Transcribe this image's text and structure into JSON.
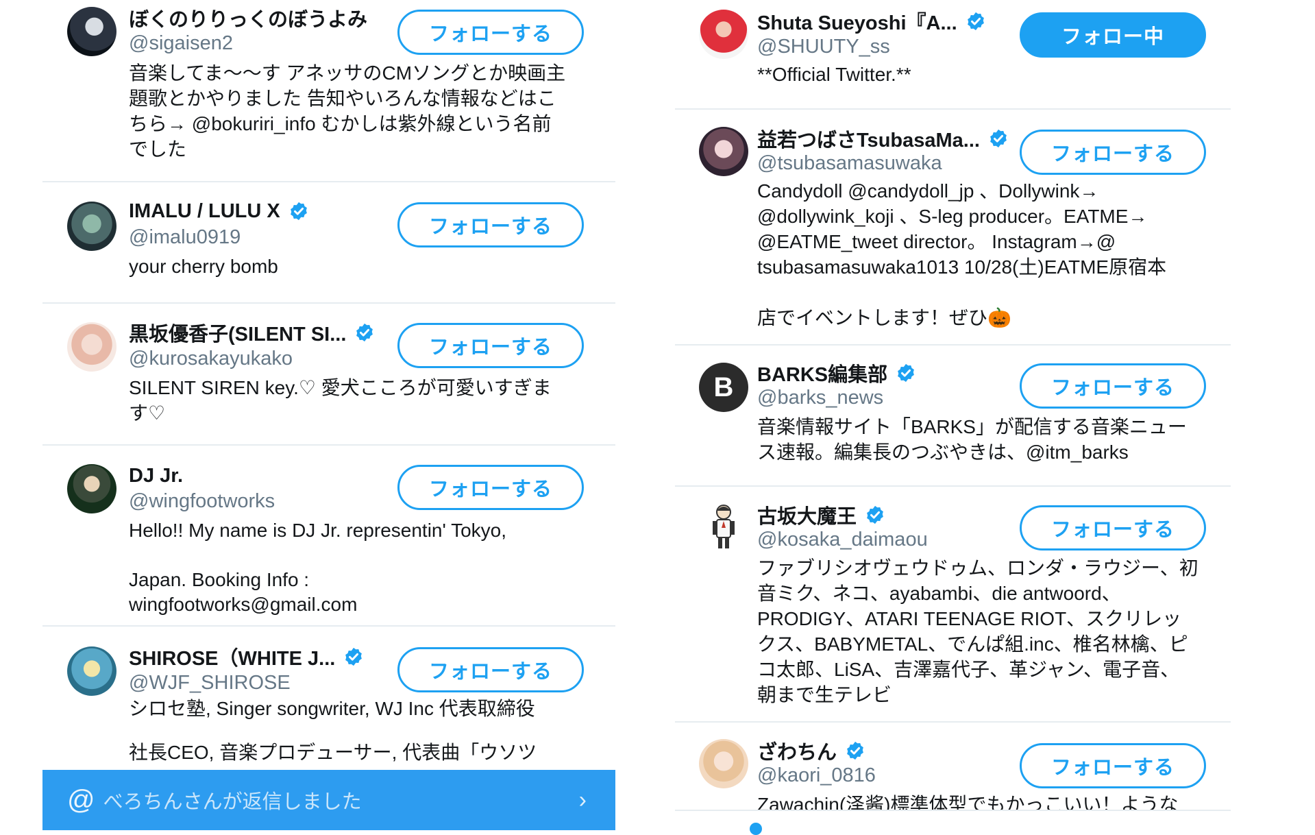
{
  "colors": {
    "accent": "#1da1f2",
    "secondary_text": "#657786",
    "divider": "#e6ecf0"
  },
  "left_column": [
    {
      "name": "ぼくのりりっくのぼうよみ",
      "handle": "@sigaisen2",
      "verified": false,
      "bio": "音楽してま〜〜す アネッサのCMソングとか映画主\n題歌とかやりました 告知やいろんな情報などはこ\nちら→ @bokuriri_info むかしは紫外線という名前\nでした",
      "button": "フォローする",
      "avatar_icon": "user-avatar-photo"
    },
    {
      "name": "IMALU / LULU X",
      "handle": "@imalu0919",
      "verified": true,
      "bio": "your cherry bomb",
      "button": "フォローする",
      "avatar_icon": "user-avatar-photo"
    },
    {
      "name": "黒坂優香子(SILENT SI...",
      "handle": "@kurosakayukako",
      "verified": true,
      "bio": "SILENT SIREN key.♡ 愛犬こころが可愛いすぎま\nす♡",
      "button": "フォローする",
      "avatar_icon": "user-avatar-photo"
    },
    {
      "name": "DJ Jr.",
      "handle": "@wingfootworks",
      "verified": false,
      "bio": "Hello!! My name is DJ Jr. representin' Tokyo,\n\nJapan. Booking Info :\nwingfootworks@gmail.com",
      "button": "フォローする",
      "avatar_icon": "user-avatar-photo"
    },
    {
      "name": "SHIROSE（WHITE J...",
      "handle": "@WJF_SHIROSE",
      "verified": true,
      "bio": "シロセ塾, Singer songwriter, WJ Inc 代表取締役\n\n社長CEO, 音楽プロデューサー, 代表曲「ウソツ",
      "button": "フォローする",
      "avatar_icon": "user-avatar-photo"
    }
  ],
  "right_column": [
    {
      "name": "Shuta  Sueyoshi『A...",
      "handle": "@SHUUTY_ss",
      "verified": true,
      "bio": "**Official Twitter.**",
      "button": "フォロー中",
      "following": true,
      "avatar_icon": "user-avatar-photo"
    },
    {
      "name": "益若つばさTsubasaMa...",
      "handle": "@tsubasamasuwaka",
      "verified": true,
      "bio": "Candydoll @candydoll_jp 、Dollywink→\n@dollywink_koji 、S-leg producer。EATME→\n@EATME_tweet director。 Instagram→@\ntsubasamasuwaka1013 10/28(土)EATME原宿本\n\n店でイベントします！ぜひ🎃",
      "button": "フォローする",
      "following": false,
      "avatar_icon": "user-avatar-photo"
    },
    {
      "name": "BARKS編集部",
      "handle": "@barks_news",
      "verified": true,
      "bio": "音楽情報サイト「BARKS」が配信する音楽ニュー\nス速報。編集長のつぶやきは、@itm_barks",
      "button": "フォローする",
      "following": false,
      "avatar_letter": "B",
      "avatar_icon": "letter-avatar"
    },
    {
      "name": "古坂大魔王",
      "handle": "@kosaka_daimaou",
      "verified": true,
      "bio": "ファブリシオヴェウドゥム、ロンダ・ラウジー、初\n音ミク、ネコ、ayabambi、die antwoord、\nPRODIGY、ATARI TEENAGE RIOT、スクリレッ\nクス、BABYMETAL、でんぱ組.inc、椎名林檎、ピ\nコ太郎、LiSA、吉澤嘉代子、革ジャン、電子音、\n朝まで生テレビ",
      "button": "フォローする",
      "following": false,
      "avatar_icon": "user-avatar-illustration"
    },
    {
      "name": "ざわちん",
      "handle": "@kaori_0816",
      "verified": true,
      "bio": "Zawachin(泽酱)標準体型でもかっこいい！ような",
      "button": "フォローする",
      "following": false,
      "avatar_icon": "user-avatar-photo"
    }
  ],
  "notification": {
    "at_icon": "@",
    "text": "べろちんさんが返信しました",
    "chevron": "›"
  }
}
